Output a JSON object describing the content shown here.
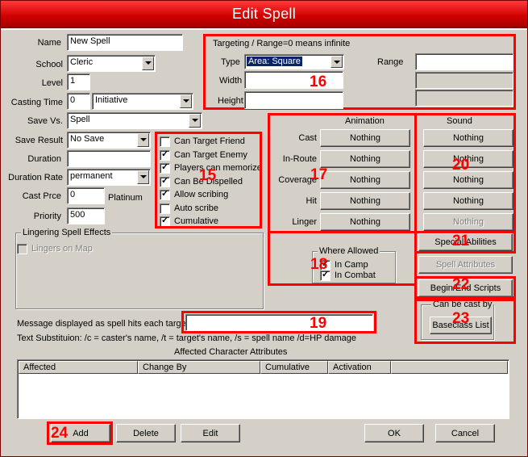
{
  "window": {
    "title": "Edit Spell"
  },
  "left": {
    "name_label": "Name",
    "name_value": "New Spell",
    "school_label": "School",
    "school_value": "Cleric",
    "level_label": "Level",
    "level_value": "1",
    "casting_time_label": "Casting Time",
    "casting_time_value": "0",
    "casting_time_unit": "Initiative",
    "save_vs_label": "Save Vs.",
    "save_vs_value": "Spell",
    "save_result_label": "Save Result",
    "save_result_value": "No Save",
    "duration_label": "Duration",
    "duration_rate_label": "Duration Rate",
    "duration_rate_value": "permanent",
    "cast_price_label": "Cast Prce",
    "cast_price_value": "0",
    "cast_price_unit": "Platinum",
    "priority_label": "Priority",
    "priority_value": "500"
  },
  "flags": {
    "items": [
      {
        "label": "Can Target Friend",
        "checked": false
      },
      {
        "label": "Can Target Enemy",
        "checked": true
      },
      {
        "label": "Players can memorize",
        "checked": true
      },
      {
        "label": "Can Be Dispelled",
        "checked": true
      },
      {
        "label": "Allow scribing",
        "checked": true
      },
      {
        "label": "Auto scribe",
        "checked": false
      },
      {
        "label": "Cumulative",
        "checked": true
      }
    ]
  },
  "lingering": {
    "group_title": "Lingering Spell Effects",
    "lingers_on_map": "Lingers on Map"
  },
  "targeting": {
    "group_title": "Targeting / Range=0 means infinite",
    "type_label": "Type",
    "type_value": "Area: Square",
    "width_label": "Width",
    "height_label": "Height",
    "range_label": "Range"
  },
  "animation": {
    "header": "Animation",
    "rows": [
      {
        "label": "Cast",
        "value": "Nothing"
      },
      {
        "label": "In-Route",
        "value": "Nothing"
      },
      {
        "label": "Coverage",
        "value": "Nothing"
      },
      {
        "label": "Hit",
        "value": "Nothing"
      },
      {
        "label": "Linger",
        "value": "Nothing"
      }
    ]
  },
  "sound": {
    "header": "Sound",
    "values": [
      "Nothing",
      "Nothing",
      "Nothing",
      "Nothing",
      "Nothing"
    ]
  },
  "where_allowed": {
    "group_title": "Where Allowed",
    "in_camp": "In Camp",
    "in_combat": "In Combat"
  },
  "right_buttons": {
    "special_abilities": "Special Abilities",
    "spell_attributes": "Spell Attributes",
    "begin_end_scripts": "Begin/End Scripts",
    "can_be_cast_by": "Can be cast by",
    "baseclass_list": "Baseclass List"
  },
  "message": {
    "label": "Message displayed as spell hits each target",
    "value": "",
    "substitution_help": "Text Substituion: /c = caster's name,  /t = target's name,  /s = spell name /d=HP damage"
  },
  "affected": {
    "title": "Affected Character Attributes",
    "columns": [
      "Affected",
      "Change By",
      "Cumulative",
      "Activation"
    ]
  },
  "bottom_buttons": {
    "add": "Add",
    "delete": "Delete",
    "edit": "Edit",
    "ok": "OK",
    "cancel": "Cancel"
  },
  "annotations": [
    "15",
    "16",
    "17",
    "18",
    "19",
    "20",
    "21",
    "22",
    "23",
    "24"
  ],
  "colors": {
    "title_bar": "#d00000",
    "annotation": "#ff0000",
    "selection": "#0a246a",
    "dialog": "#d4d0c8"
  }
}
